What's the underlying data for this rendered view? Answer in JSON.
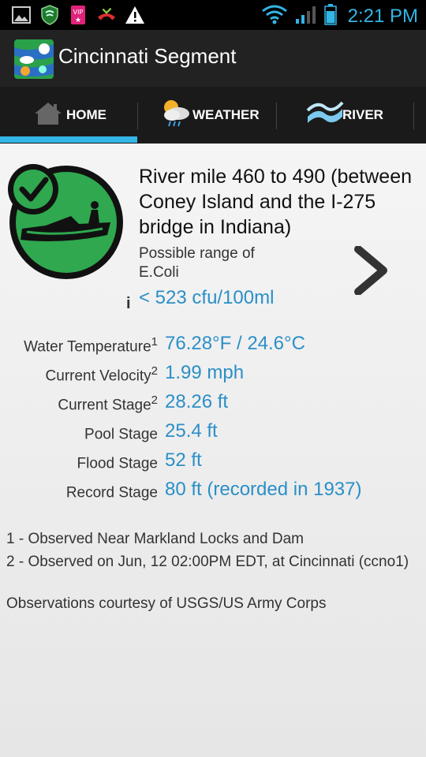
{
  "statusbar": {
    "time": "2:21 PM",
    "icons_left": [
      "image-icon",
      "shield-icon",
      "vip-icon",
      "missed-call-icon",
      "warning-icon"
    ],
    "icons_right": [
      "wifi-icon",
      "signal-icon",
      "battery-icon"
    ]
  },
  "app": {
    "title": "Cincinnati Segment"
  },
  "tabs": [
    {
      "label": "HOME",
      "icon": "home-icon",
      "selected": true
    },
    {
      "label": "WEATHER",
      "icon": "weather-icon",
      "selected": false
    },
    {
      "label": "RIVER",
      "icon": "river-icon",
      "selected": false
    }
  ],
  "segment": {
    "title": "River mile 460 to 490 (between Coney Island and the I-275 bridge in Indiana)",
    "ecoli_label": "Possible range of E.Coli",
    "ecoli_value": "< 523 cfu/100ml",
    "info_label": "i"
  },
  "observations": [
    {
      "label": "Water Temperature",
      "sup": "1",
      "value": "76.28°F / 24.6°C"
    },
    {
      "label": "Current Velocity",
      "sup": "2",
      "value": "1.99 mph"
    },
    {
      "label": "Current Stage",
      "sup": "2",
      "value": "28.26 ft"
    },
    {
      "label": "Pool Stage",
      "sup": "",
      "value": "25.4 ft"
    },
    {
      "label": "Flood Stage",
      "sup": "",
      "value": "52 ft"
    },
    {
      "label": "Record Stage",
      "sup": "",
      "value": "80 ft (recorded in 1937)"
    }
  ],
  "footnotes": {
    "note1": "1 - Observed Near Markland Locks and Dam",
    "note2": "2 - Observed on Jun, 12 02:00PM EDT, at Cincinnati (ccno1)",
    "courtesy": "Observations courtesy of USGS/US Army Corps"
  },
  "colors": {
    "accent": "#33b5e5",
    "value": "#2a8fc7",
    "badge_green": "#2fa84f"
  }
}
